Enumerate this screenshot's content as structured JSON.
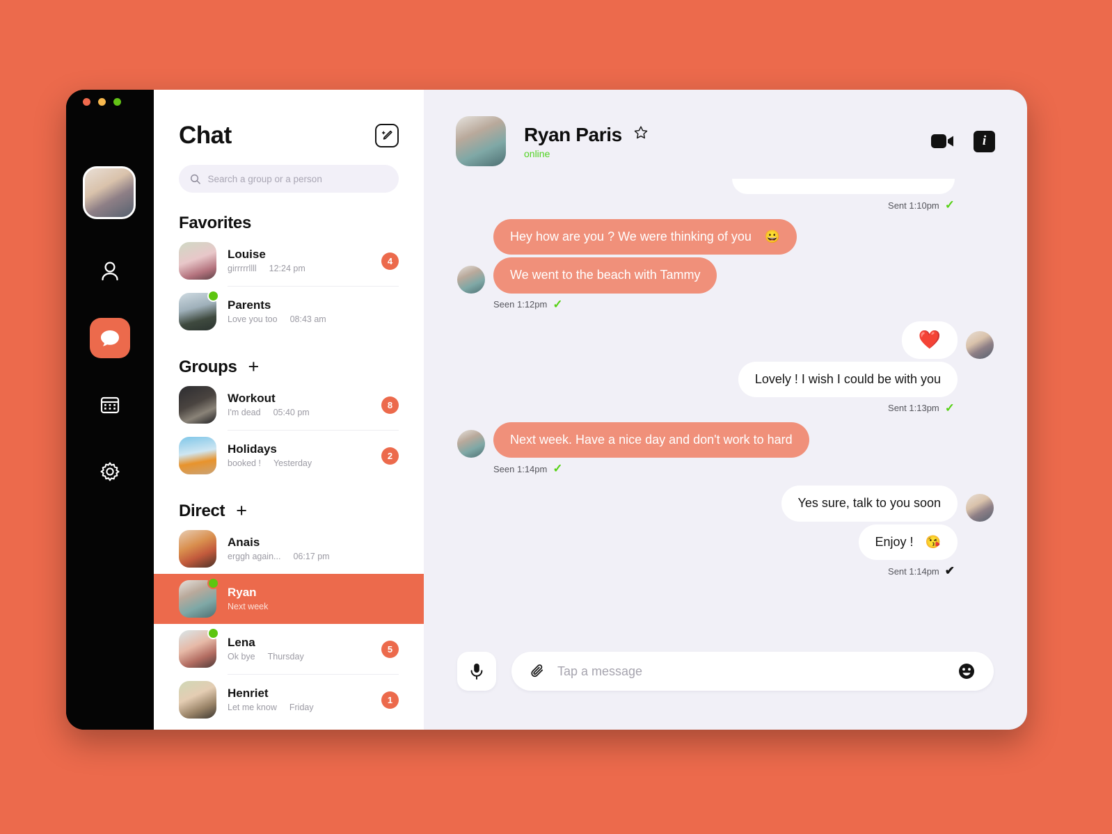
{
  "window": {
    "traffic_lights": [
      "close",
      "minimize",
      "maximize"
    ]
  },
  "rail": {
    "avatar_name": "user-avatar",
    "items": [
      {
        "icon": "person-icon",
        "name": "contacts",
        "active": false
      },
      {
        "icon": "chat-bubble-icon",
        "name": "chat",
        "active": true
      },
      {
        "icon": "calendar-icon",
        "name": "calendar",
        "active": false
      },
      {
        "icon": "gear-icon",
        "name": "settings",
        "active": false
      }
    ]
  },
  "sidebar": {
    "title": "Chat",
    "compose_icon": "compose-pencil-icon",
    "search": {
      "placeholder": "Search a group or a person",
      "value": "",
      "icon": "search-icon"
    },
    "sections": [
      {
        "title": "Favorites",
        "has_add": false,
        "items": [
          {
            "name": "Louise",
            "preview": "girrrrrllll",
            "time": "12:24 pm",
            "badge": "4",
            "online": false
          },
          {
            "name": "Parents",
            "preview": "Love you too",
            "time": "08:43 am",
            "badge": "",
            "online": true
          }
        ]
      },
      {
        "title": "Groups",
        "has_add": true,
        "add_label": "+",
        "items": [
          {
            "name": "Workout",
            "preview": "I'm dead",
            "time": "05:40 pm",
            "badge": "8",
            "online": false
          },
          {
            "name": "Holidays",
            "preview": "booked !",
            "time": "Yesterday",
            "badge": "2",
            "online": false
          }
        ]
      },
      {
        "title": "Direct",
        "has_add": true,
        "add_label": "+",
        "items": [
          {
            "name": "Anais",
            "preview": "erggh again...",
            "time": "06:17 pm",
            "badge": "",
            "online": false
          },
          {
            "name": "Ryan",
            "preview": "Next week",
            "time": "",
            "badge": "",
            "online": true,
            "selected": true
          },
          {
            "name": "Lena",
            "preview": "Ok bye",
            "time": "Thursday",
            "badge": "5",
            "online": true
          },
          {
            "name": "Henriet",
            "preview": "Let me know",
            "time": "Friday",
            "badge": "1",
            "online": false
          }
        ]
      }
    ]
  },
  "conversation": {
    "contact_name": "Ryan Paris",
    "status": "online",
    "favorite_icon": "star-icon",
    "actions": [
      {
        "icon": "video-camera-icon",
        "name": "video-call"
      },
      {
        "icon": "info-icon",
        "name": "conversation-info",
        "label": "i"
      }
    ],
    "messages": [
      {
        "id": "m0",
        "side": "out",
        "type": "cutoff",
        "text": "",
        "meta": "Sent 1:10pm",
        "tick": "✓",
        "tick_color": "green"
      },
      {
        "id": "m1",
        "side": "in",
        "type": "text",
        "text": "Hey how are you ? We were thinking of you",
        "emoji": "😀"
      },
      {
        "id": "m2",
        "side": "in",
        "type": "text",
        "text": "We went to the beach with Tammy",
        "meta": "Seen 1:12pm",
        "tick": "✓",
        "tick_color": "green"
      },
      {
        "id": "m3",
        "side": "out",
        "type": "emoji",
        "text": "❤️"
      },
      {
        "id": "m4",
        "side": "out",
        "type": "text",
        "text": "Lovely ! I wish I could be with you",
        "meta": "Sent 1:13pm",
        "tick": "✓",
        "tick_color": "green"
      },
      {
        "id": "m5",
        "side": "in",
        "type": "text",
        "text": "Next week. Have a nice  day and don't work to hard",
        "meta": "Seen 1:14pm",
        "tick": "✓",
        "tick_color": "green"
      },
      {
        "id": "m6",
        "side": "out",
        "type": "text",
        "text": "Yes sure, talk to you soon"
      },
      {
        "id": "m7",
        "side": "out",
        "type": "text",
        "text": "Enjoy !",
        "emoji": "😘",
        "meta": "Sent 1:14pm",
        "tick": "✔",
        "tick_color": "dark"
      }
    ]
  },
  "composer": {
    "mic_icon": "microphone-icon",
    "attach_icon": "paperclip-icon",
    "emoji_icon": "emoji-smiley-icon",
    "placeholder": "Tap a message",
    "value": ""
  },
  "colors": {
    "accent": "#EC6A4C",
    "bubble_in": "#F0907A",
    "panel_bg": "#F1F0F7",
    "online": "#51D322",
    "tick": "#57D116"
  }
}
